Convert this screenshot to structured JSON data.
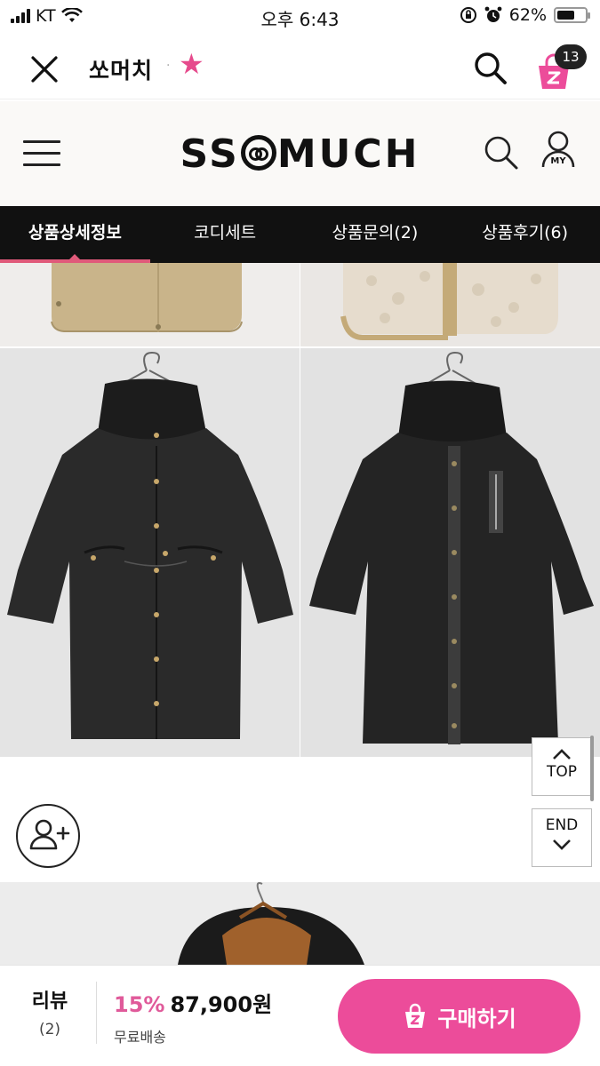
{
  "status_bar": {
    "carrier": "KT",
    "time": "오후 6:43",
    "battery": "62%",
    "battery_level": 0.62
  },
  "app_header": {
    "shop_name": "쏘머치",
    "separator": "·",
    "cart_badge": "13"
  },
  "site_header": {
    "logo_left": "SS",
    "logo_right": "MUCH",
    "my_label": "MY"
  },
  "tabs": [
    {
      "label": "상품상세정보",
      "active": true
    },
    {
      "label": "코디세트",
      "active": false
    },
    {
      "label": "상품문의(2)",
      "active": false
    },
    {
      "label": "상품후기(6)",
      "active": false
    }
  ],
  "side_buttons": {
    "top": "TOP",
    "end": "END"
  },
  "bottom_bar": {
    "review_label": "리뷰",
    "review_count": "(2)",
    "discount": "15%",
    "price": "87,900원",
    "shipping": "무료배송",
    "buy_label": "구매하기"
  },
  "colors": {
    "accent_pink": "#ec4c9a",
    "tab_bar": "#111111",
    "tab_indicator": "#e05a7a",
    "star": "#e64a8c"
  }
}
